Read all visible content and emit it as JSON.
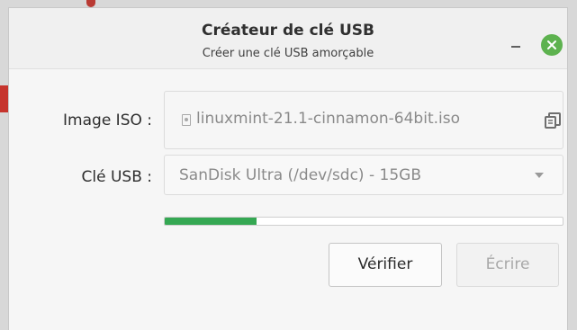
{
  "window": {
    "title": "Créateur de clé USB",
    "subtitle": "Créer une clé USB amorçable",
    "minimize_label": "–",
    "close_label": "×"
  },
  "form": {
    "iso_label": "Image ISO :",
    "iso_value": "linuxmint-21.1-cinnamon-64bit.iso",
    "usb_label": "Clé USB :",
    "usb_selected": "SanDisk Ultra (/dev/sdc) - 15GB"
  },
  "progress": {
    "fraction": 0.23,
    "color": "#35a853"
  },
  "buttons": {
    "verify_label": "Vérifier",
    "write_label": "Écrire"
  },
  "icons": {
    "close": "close-icon",
    "file": "file-icon",
    "copy": "copy-icon",
    "dropdown": "chevron-down-icon"
  },
  "colors": {
    "close_button": "#5db24f",
    "progress": "#35a853"
  }
}
